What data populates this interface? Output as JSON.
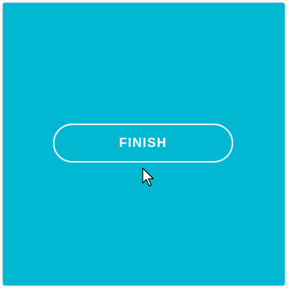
{
  "colors": {
    "background": "#00b8d1",
    "button_border": "#ffffff",
    "button_text": "#ffffff"
  },
  "main": {
    "finish_label": "FINISH"
  },
  "cursor": {
    "icon": "arrow-pointer-icon"
  }
}
